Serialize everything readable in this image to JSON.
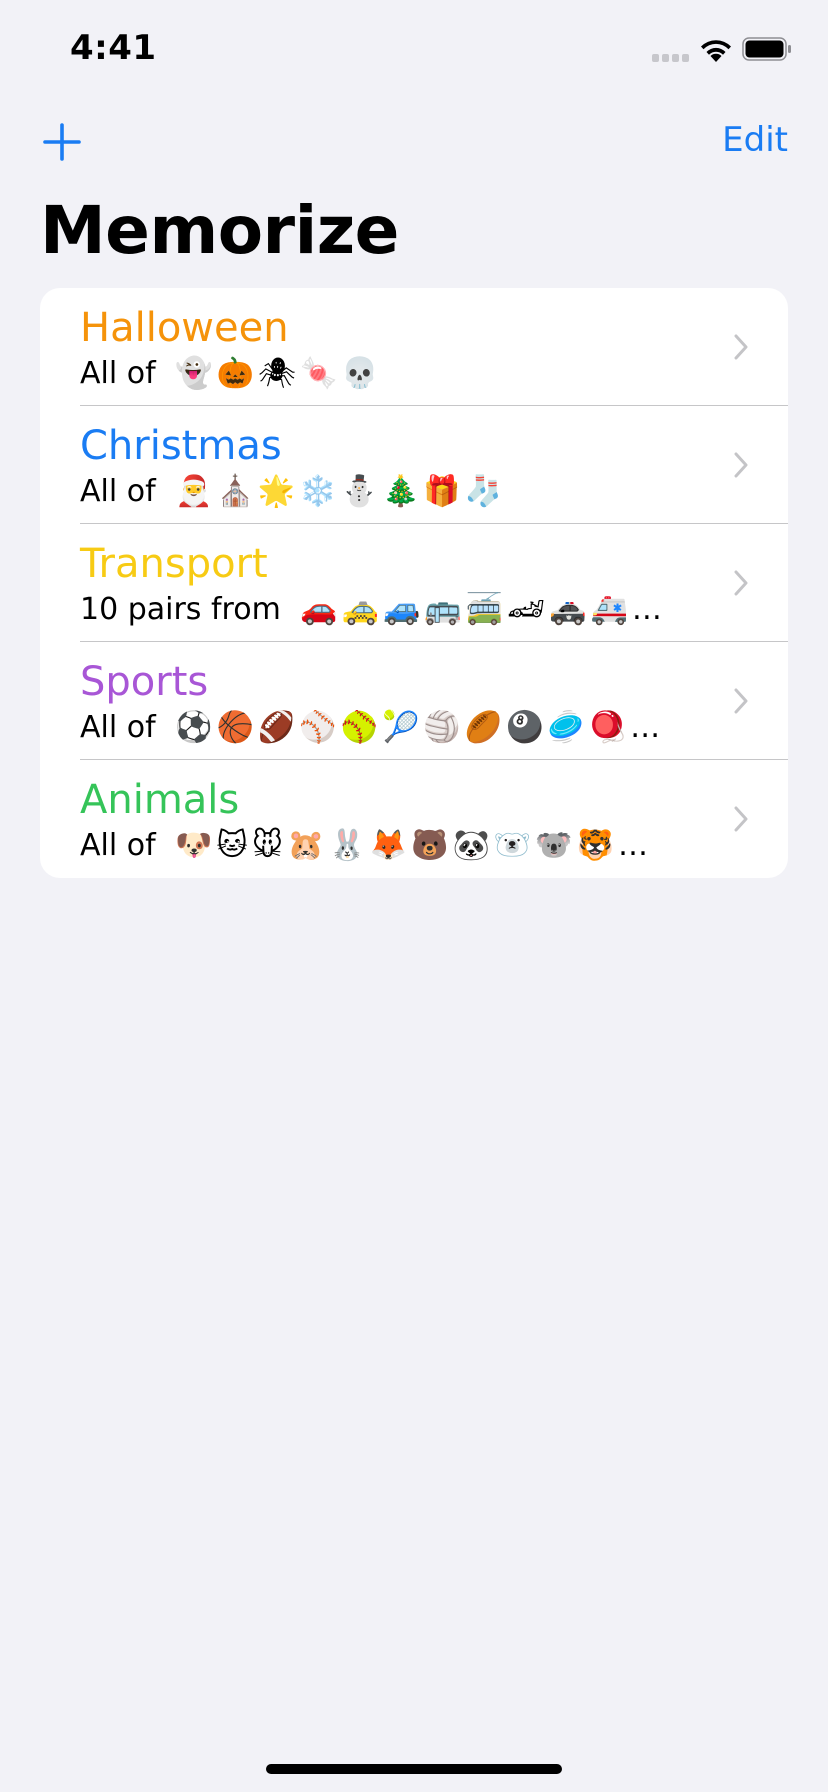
{
  "status_bar": {
    "time": "4:41"
  },
  "nav": {
    "add_icon": "plus-icon",
    "edit_label": "Edit",
    "title": "Memorize"
  },
  "accent_color": "#1A7CF3",
  "themes": [
    {
      "name": "Halloween",
      "color": "#F5930A",
      "prefix": "All of",
      "emojis": "👻🎃🕷🍬💀"
    },
    {
      "name": "Christmas",
      "color": "#1A7CF3",
      "prefix": "All of",
      "emojis": "🎅⛪🌟❄️⛄🎄🎁🧦"
    },
    {
      "name": "Transport",
      "color": "#F7CB14",
      "prefix": "10 pairs from",
      "emojis": "🚗🚕🚙🚌🚎🏎🚓🚑…"
    },
    {
      "name": "Sports",
      "color": "#A856D6",
      "prefix": "All of",
      "emojis": "⚽🏀🏈⚾🥎🎾🏐🏉🎱🥏🪀…"
    },
    {
      "name": "Animals",
      "color": "#35C459",
      "prefix": "All of",
      "emojis": "🐶🐱🐭🐹🐰🦊🐻🐼🐻‍❄️🐨🐯…"
    }
  ]
}
